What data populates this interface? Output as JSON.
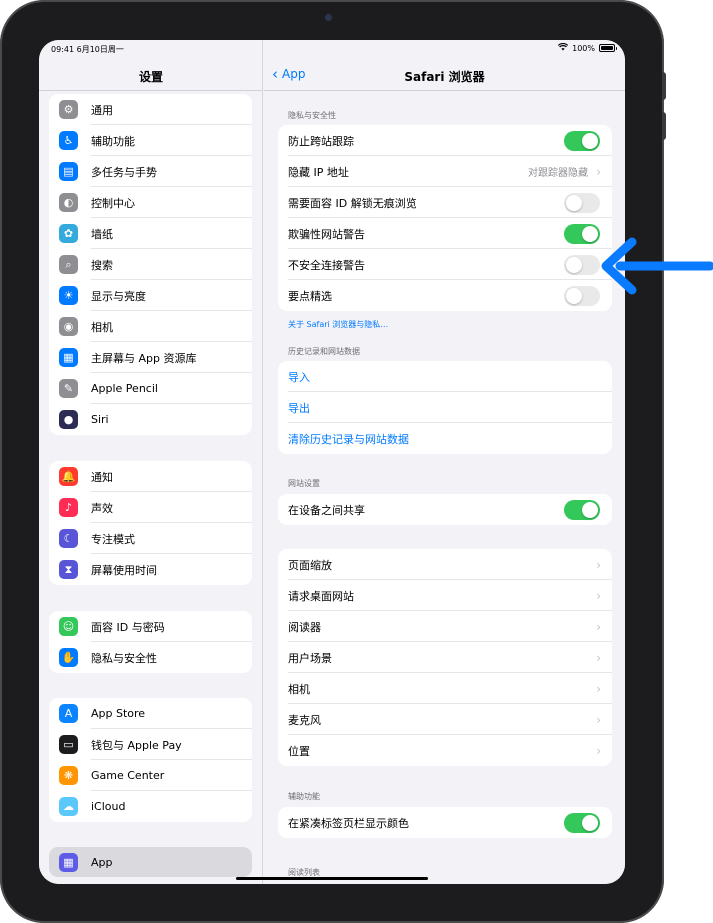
{
  "status_bar": {
    "time": "09:41",
    "date": "6月10日周一",
    "battery": "100%"
  },
  "sidebar": {
    "title": "设置",
    "groups": [
      [
        {
          "label": "通用",
          "icon": "gear-icon",
          "color": "#8e8e93",
          "glyph": "⚙"
        },
        {
          "label": "辅助功能",
          "icon": "accessibility-icon",
          "color": "#007aff",
          "glyph": "♿"
        },
        {
          "label": "多任务与手势",
          "icon": "multitasking-icon",
          "color": "#007aff",
          "glyph": "▤"
        },
        {
          "label": "控制中心",
          "icon": "control-center-icon",
          "color": "#8e8e93",
          "glyph": "◐"
        },
        {
          "label": "墙纸",
          "icon": "wallpaper-icon",
          "color": "#34aadc",
          "glyph": "✿"
        },
        {
          "label": "搜索",
          "icon": "search-icon",
          "color": "#8e8e93",
          "glyph": "⌕"
        },
        {
          "label": "显示与亮度",
          "icon": "brightness-icon",
          "color": "#007aff",
          "glyph": "☀"
        },
        {
          "label": "相机",
          "icon": "camera-icon",
          "color": "#8e8e93",
          "glyph": "◉"
        },
        {
          "label": "主屏幕与 App 资源库",
          "icon": "home-screen-icon",
          "color": "#007aff",
          "glyph": "▦"
        },
        {
          "label": "Apple Pencil",
          "icon": "pencil-icon",
          "color": "#8e8e93",
          "glyph": "✎"
        },
        {
          "label": "Siri",
          "icon": "siri-icon",
          "color": "#2c2c54",
          "glyph": "●"
        }
      ],
      [
        {
          "label": "通知",
          "icon": "notifications-icon",
          "color": "#ff3b30",
          "glyph": "🔔"
        },
        {
          "label": "声效",
          "icon": "sounds-icon",
          "color": "#ff2d55",
          "glyph": "♪"
        },
        {
          "label": "专注模式",
          "icon": "focus-icon",
          "color": "#5856d6",
          "glyph": "☾"
        },
        {
          "label": "屏幕使用时间",
          "icon": "screen-time-icon",
          "color": "#5856d6",
          "glyph": "⧗"
        }
      ],
      [
        {
          "label": "面容 ID 与密码",
          "icon": "face-id-icon",
          "color": "#34c759",
          "glyph": "☺"
        },
        {
          "label": "隐私与安全性",
          "icon": "privacy-hand-icon",
          "color": "#007aff",
          "glyph": "✋"
        }
      ],
      [
        {
          "label": "App Store",
          "icon": "app-store-icon",
          "color": "#0a84ff",
          "glyph": "A"
        },
        {
          "label": "钱包与 Apple Pay",
          "icon": "wallet-icon",
          "color": "#1c1c1e",
          "glyph": "▭"
        },
        {
          "label": "Game Center",
          "icon": "game-center-icon",
          "color": "#ff9500",
          "glyph": "❋"
        },
        {
          "label": "iCloud",
          "icon": "icloud-icon",
          "color": "#5ac8fa",
          "glyph": "☁"
        }
      ]
    ],
    "selected": {
      "label": "App",
      "icon": "apps-grid-icon",
      "glyph": "▦"
    }
  },
  "detail": {
    "back_label": "App",
    "title": "Safari 浏览器",
    "privacy_header": "隐私与安全性",
    "privacy_rows": [
      {
        "label": "防止跨站跟踪",
        "toggle": true
      },
      {
        "label": "隐藏 IP 地址",
        "value": "对跟踪器隐藏"
      },
      {
        "label": "需要面容 ID 解锁无痕浏览",
        "toggle": false
      },
      {
        "label": "欺骗性网站警告",
        "toggle": true
      },
      {
        "label": "不安全连接警告",
        "toggle": false
      },
      {
        "label": "要点精选",
        "toggle": false
      }
    ],
    "privacy_footer_link": "关于 Safari 浏览器与隐私…",
    "history_header": "历史记录和网站数据",
    "history_rows": [
      "导入",
      "导出",
      "清除历史记录与网站数据"
    ],
    "website_header": "网站设置",
    "share_row": {
      "label": "在设备之间共享",
      "toggle": true
    },
    "site_rows": [
      "页面缩放",
      "请求桌面网站",
      "阅读器",
      "用户场景",
      "相机",
      "麦克风",
      "位置"
    ],
    "accessibility_header": "辅助功能",
    "accessibility_row": {
      "label": "在紧凑标签页栏显示颜色",
      "toggle": true
    },
    "reading_list_header": "阅读列表"
  },
  "callout_color": "#0a7aff"
}
